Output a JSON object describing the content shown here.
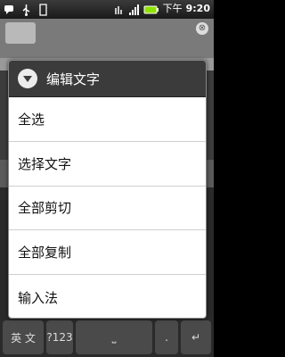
{
  "status_bar": {
    "ampm": "下午",
    "time": "9:20",
    "icons_left": [
      "chat-icon",
      "usb-icon",
      "sd-card-icon"
    ],
    "icons_right": [
      "signal-3g-icon",
      "signal-bars-icon",
      "battery-icon"
    ]
  },
  "dialog": {
    "title": "编辑文字",
    "items": [
      {
        "label": "全选"
      },
      {
        "label": "选择文字"
      },
      {
        "label": "全部剪切"
      },
      {
        "label": "全部复制"
      },
      {
        "label": "输入法"
      }
    ]
  },
  "keyboard": {
    "lang_key": "英 文",
    "num_key": "?123",
    "space_key": "⎵",
    "dot_key": ".",
    "enter_key": "↵"
  },
  "app": {
    "close_glyph": "⊗"
  }
}
